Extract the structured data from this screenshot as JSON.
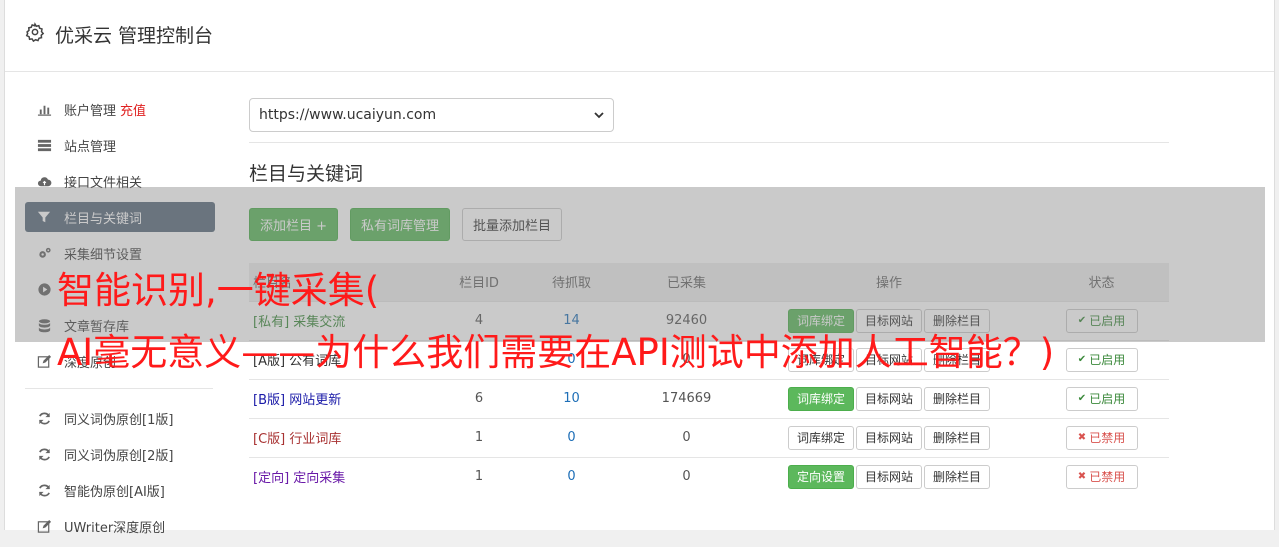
{
  "header": {
    "title": "优采云 管理控制台"
  },
  "sidebar": {
    "items": [
      {
        "label": "账户管理",
        "extra": "充值",
        "icon": "bar-chart-icon"
      },
      {
        "label": "站点管理",
        "icon": "server-icon"
      },
      {
        "label": "接口文件相关",
        "icon": "cloud-upload-icon"
      },
      {
        "label": "栏目与关键词",
        "icon": "filter-icon",
        "active": true
      },
      {
        "label": "采集细节设置",
        "icon": "gears-icon"
      },
      {
        "label": "",
        "icon": "play-circle-icon"
      },
      {
        "label": "文章暂存库",
        "icon": "database-icon"
      },
      {
        "label": "深度原创",
        "icon": "edit-icon"
      }
    ],
    "items2": [
      {
        "label": "同义词伪原创[1版]",
        "icon": "refresh-icon"
      },
      {
        "label": "同义词伪原创[2版]",
        "icon": "refresh-icon"
      },
      {
        "label": "智能伪原创[AI版]",
        "icon": "refresh-icon"
      },
      {
        "label": "UWriter深度原创",
        "icon": "edit-icon"
      }
    ]
  },
  "main": {
    "site_select": "https://www.ucaiyun.com",
    "section_title": "栏目与关键词",
    "buttons": {
      "add": "添加栏目 +",
      "private_lib": "私有词库管理",
      "batch_add": "批量添加栏目"
    },
    "table": {
      "headers": [
        "栏目名",
        "栏目ID",
        "待抓取",
        "已采集",
        "操作",
        "状态"
      ],
      "rows": [
        {
          "tag": "[私有]",
          "name": "采集交流",
          "id": "4",
          "pending": "14",
          "collected": "92460",
          "op1": "词库绑定",
          "op1_green": true,
          "op2": "目标网站",
          "op3": "删除栏目",
          "status": "已启用",
          "on": true,
          "color": "#3c8a3c"
        },
        {
          "tag": "[A版]",
          "name": "公有词库",
          "id": "",
          "pending": "0",
          "collected": "0",
          "op1": "词库绑定",
          "op1_green": false,
          "op2": "目标网站",
          "op3": "删除栏目",
          "status": "已启用",
          "on": true,
          "color": "#333333"
        },
        {
          "tag": "[B版]",
          "name": "网站更新",
          "id": "6",
          "pending": "10",
          "collected": "174669",
          "op1": "词库绑定",
          "op1_green": true,
          "op2": "目标网站",
          "op3": "删除栏目",
          "status": "已启用",
          "on": true,
          "color": "#1a1aa8"
        },
        {
          "tag": "[C版]",
          "name": "行业词库",
          "id": "1",
          "pending": "0",
          "collected": "0",
          "op1": "词库绑定",
          "op1_green": false,
          "op2": "目标网站",
          "op3": "删除栏目",
          "status": "已禁用",
          "on": false,
          "color": "#a83232"
        },
        {
          "tag": "[定向]",
          "name": "定向采集",
          "id": "1",
          "pending": "0",
          "collected": "0",
          "op1": "定向设置",
          "op1_green": true,
          "op2": "目标网站",
          "op3": "删除栏目",
          "status": "已禁用",
          "on": false,
          "color": "#6a1aa8"
        }
      ]
    }
  },
  "overlay": {
    "line1": "智能识别,一键采集(",
    "line2": "AI毫无意义——为什么我们需要在API测试中添加人工智能？)"
  }
}
